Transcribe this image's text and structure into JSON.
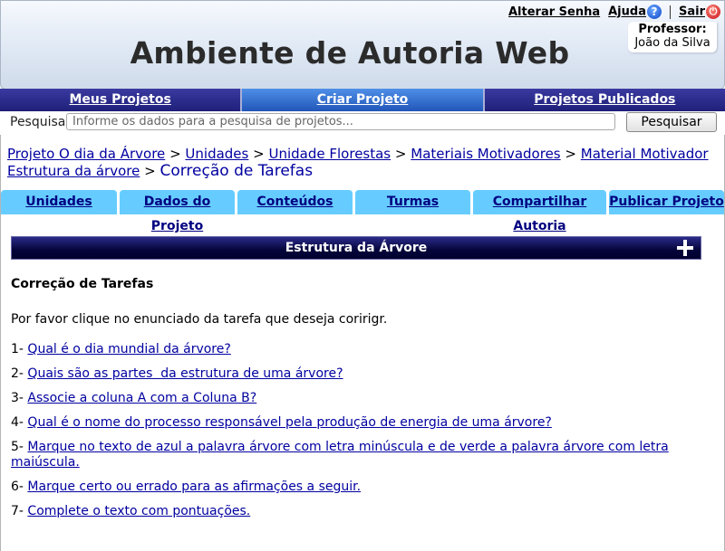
{
  "header": {
    "title": "Ambiente de Autoria Web",
    "links": {
      "change_password": "Alterar Senha",
      "help": "Ajuda",
      "logout": "Sair"
    },
    "help_icon": "question-icon",
    "logout_icon": "power-icon",
    "professor_label": "Professor:",
    "professor_name": "João da Silva"
  },
  "main_nav": {
    "items": [
      "Meus Projetos",
      "Criar Projeto",
      "Projetos Publicados"
    ],
    "active": "Criar Projeto"
  },
  "search": {
    "label": "Pesquisa",
    "placeholder": "Informe os dados para a pesquisa de projetos...",
    "button": "Pesquisar"
  },
  "breadcrumb": {
    "items": [
      "Projeto O dia da Árvore",
      "Unidades",
      "Unidade Florestas",
      "Materiais Motivadores",
      "Material Motivador Estrutura da árvore"
    ],
    "separator": ">",
    "current": "Correção de Tarefas"
  },
  "tabs": [
    "Unidades",
    "Dados do Projeto",
    "Conteúdos",
    "Turmas",
    "Compartilhar Autoria",
    "Publicar Projeto"
  ],
  "tree": {
    "title": "Estrutura da Árvore",
    "expand_icon": "plus-icon"
  },
  "section": {
    "title": "Correção de Tarefas",
    "instruction": "Por favor clique no enunciado da tarefa que deseja coririgr."
  },
  "tasks": [
    {
      "number": "1-",
      "text": "Qual é o dia mundial da árvore?"
    },
    {
      "number": "2-",
      "text": "Quais são as partes  da estrutura de uma árvore?"
    },
    {
      "number": "3-",
      "text": "Associe a coluna A com a Coluna B?"
    },
    {
      "number": "4-",
      "text": "Qual é o nome do processo responsável pela produção de energia de uma árvore?"
    },
    {
      "number": "5-",
      "text": "Marque no texto de azul a palavra árvore com letra minúscula e de verde a palavra árvore com letra maiúscula."
    },
    {
      "number": "6-",
      "text": "Marque certo ou errado para as afirmações a seguir."
    },
    {
      "number": "7-",
      "text": "Complete o texto com pontuações."
    }
  ],
  "colors": {
    "nav_bg": "#1f1f7a",
    "nav_active": "#2156b8",
    "tab_bg": "#66ccff",
    "link": "#0000a0",
    "tree_bar": "#05053a"
  }
}
